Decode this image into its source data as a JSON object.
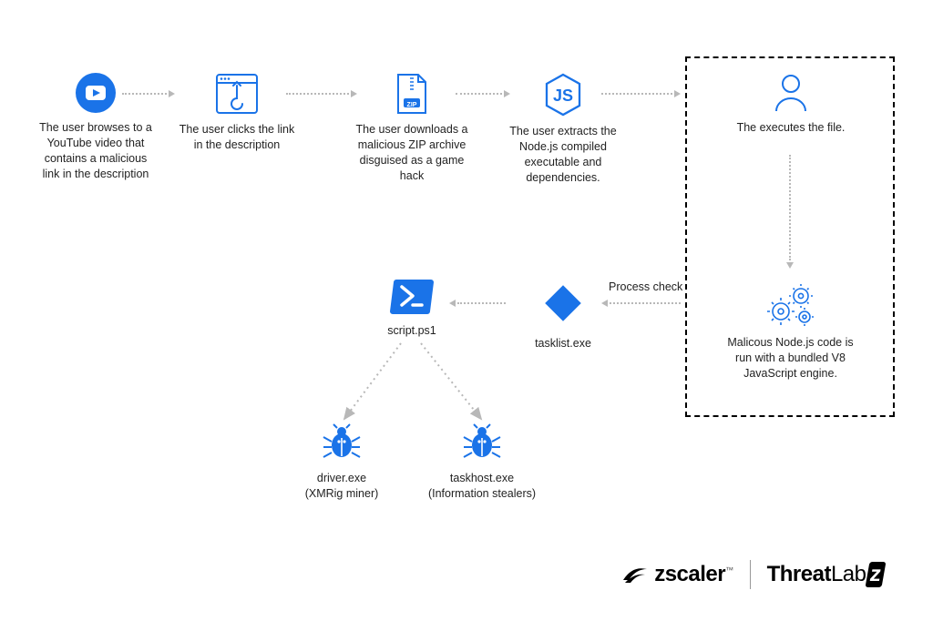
{
  "steps": {
    "youtube": "The user browses to a YouTube video  that contains a malicious link in the description",
    "click_link": "The user clicks the link in the description",
    "zip": "The user downloads a malicious ZIP archive disguised as a game hack",
    "nodejs": "The user extracts the Node.js compiled executable and dependencies.",
    "execute": "The executes the file.",
    "nodecode": "Malicous Node.js code is run with a bundled V8 JavaScript engine.",
    "tasklist": "tasklist.exe",
    "process_check": "Process check",
    "script": "script.ps1",
    "driver_name": "driver.exe",
    "driver_desc": "(XMRig miner)",
    "taskhost_name": "taskhost.exe",
    "taskhost_desc": "(Information stealers)",
    "zip_label": "ZIP"
  },
  "brand": {
    "zscaler": "zscaler",
    "tm": "™",
    "threat": "Threat",
    "labz": "Lab",
    "z": "z"
  },
  "colors": {
    "primary": "#1a73e8",
    "primary_dark": "#0a63d8"
  }
}
